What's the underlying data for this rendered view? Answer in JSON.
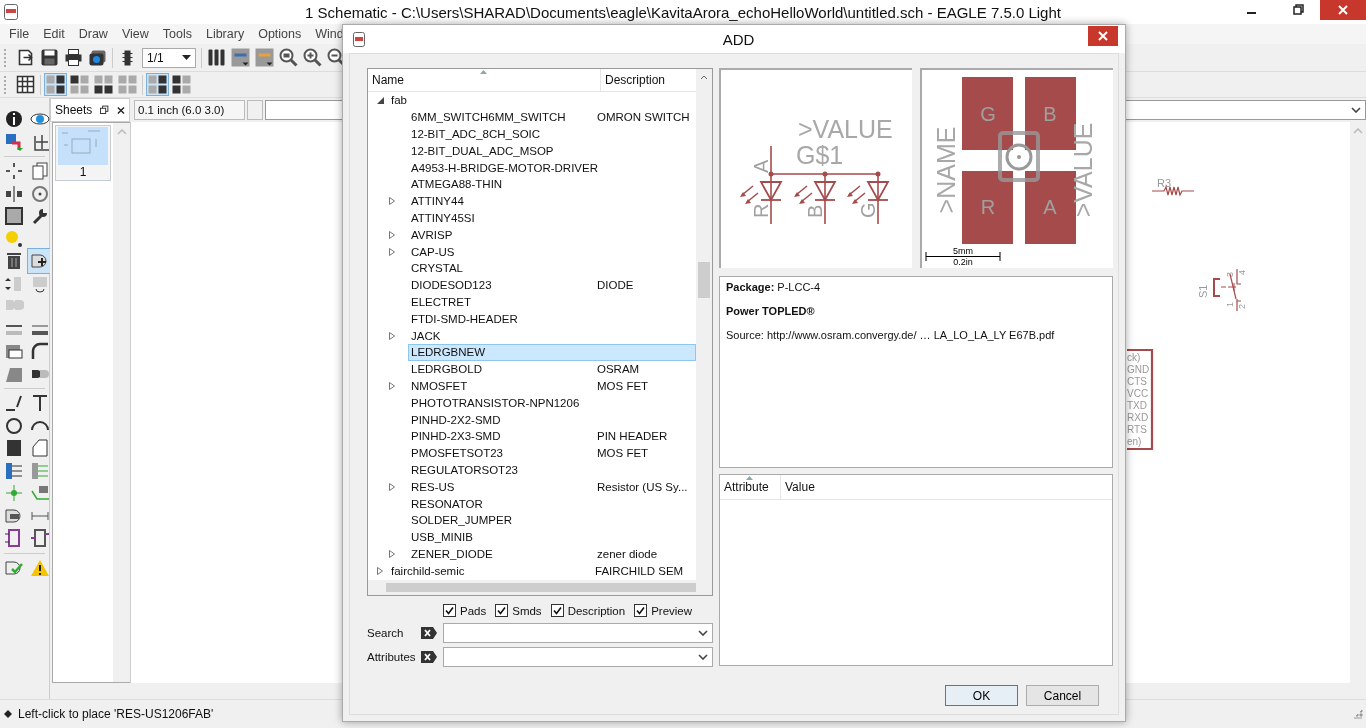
{
  "window": {
    "title": "1 Schematic - C:\\Users\\SHARAD\\Documents\\eagle\\KavitaArora_echoHelloWorld\\untitled.sch - EAGLE 7.5.0 Light"
  },
  "menu": [
    "File",
    "Edit",
    "Draw",
    "View",
    "Tools",
    "Library",
    "Options",
    "Wind"
  ],
  "toolbar": {
    "sheet_select": "1/1"
  },
  "sheets_panel": {
    "title": "Sheets",
    "sheets": [
      {
        "label": "1",
        "selected": true
      }
    ]
  },
  "coordinates": "0.1 inch (6.0 3.0)",
  "canvas": {
    "resistor_label": "R3",
    "switch_label": "S1",
    "switch_pins": [
      "3",
      "4",
      "1",
      "2"
    ],
    "connector_pins": [
      "ck)",
      "GND",
      "CTS",
      "VCC",
      "TXD",
      "RXD",
      "RTS",
      "en)"
    ]
  },
  "dialog": {
    "title": "ADD",
    "columns": [
      "Name",
      "Description"
    ],
    "tree": [
      {
        "name": "fab",
        "expanded": true,
        "selected": false,
        "children": [
          {
            "name": "6MM_SWITCH6MM_SWITCH",
            "description": "OMRON SWITCH",
            "expandable": false,
            "selected": false
          },
          {
            "name": "12-BIT_ADC_8CH_SOIC",
            "expandable": false,
            "selected": false
          },
          {
            "name": "12-BIT_DUAL_ADC_MSOP",
            "expandable": false,
            "selected": false
          },
          {
            "name": "A4953-H-BRIDGE-MOTOR-DRIVER",
            "expandable": false,
            "selected": false
          },
          {
            "name": "ATMEGA88-THIN",
            "expandable": false,
            "selected": false
          },
          {
            "name": "ATTINY44",
            "expandable": true,
            "selected": false
          },
          {
            "name": "ATTINY45SI",
            "expandable": false,
            "selected": false
          },
          {
            "name": "AVRISP",
            "expandable": true,
            "selected": false
          },
          {
            "name": "CAP-US",
            "expandable": true,
            "selected": false
          },
          {
            "name": "CRYSTAL",
            "expandable": false,
            "selected": false
          },
          {
            "name": "DIODESOD123",
            "description": "DIODE",
            "expandable": false,
            "selected": false
          },
          {
            "name": "ELECTRET",
            "expandable": false,
            "selected": false
          },
          {
            "name": "FTDI-SMD-HEADER",
            "expandable": false,
            "selected": false
          },
          {
            "name": "JACK",
            "expandable": true,
            "selected": false
          },
          {
            "name": "LEDRGBNEW",
            "expandable": false,
            "selected": true
          },
          {
            "name": "LEDRGBOLD",
            "description": "OSRAM",
            "expandable": false,
            "selected": false
          },
          {
            "name": "NMOSFET",
            "description": "MOS FET",
            "expandable": true,
            "selected": false
          },
          {
            "name": "PHOTOTRANSISTOR-NPN1206",
            "expandable": false,
            "selected": false
          },
          {
            "name": "PINHD-2X2-SMD",
            "expandable": false,
            "selected": false
          },
          {
            "name": "PINHD-2X3-SMD",
            "description": "PIN HEADER",
            "expandable": false,
            "selected": false
          },
          {
            "name": "PMOSFETSOT23",
            "description": "MOS FET",
            "expandable": false,
            "selected": false
          },
          {
            "name": "REGULATORSOT23",
            "expandable": false,
            "selected": false
          },
          {
            "name": "RES-US",
            "description": "Resistor (US Sy...",
            "expandable": true,
            "selected": false
          },
          {
            "name": "RESONATOR",
            "expandable": false,
            "selected": false
          },
          {
            "name": "SOLDER_JUMPER",
            "expandable": false,
            "selected": false
          },
          {
            "name": "USB_MINIB",
            "expandable": false,
            "selected": false
          },
          {
            "name": "ZENER_DIODE",
            "description": "zener diode",
            "expandable": true,
            "selected": false
          }
        ]
      },
      {
        "name": "fairchild-semic",
        "description": "FAIRCHILD SEM",
        "expanded": false,
        "selected": false
      }
    ],
    "filters": [
      {
        "label": "Pads",
        "checked": true
      },
      {
        "label": "Smds",
        "checked": true
      },
      {
        "label": "Description",
        "checked": true
      },
      {
        "label": "Preview",
        "checked": true
      }
    ],
    "search": {
      "label": "Search"
    },
    "attributes": {
      "label": "Attributes"
    },
    "symbol_preview": {
      "value": ">VALUE",
      "name": "G$1",
      "anode": "A",
      "leds": [
        "R",
        "B",
        "G"
      ]
    },
    "package_preview": {
      "pads": [
        "G",
        "B",
        "R",
        "A"
      ],
      "name": ">NAME",
      "value": ">VALUE",
      "scale_top": "5mm",
      "scale_bottom": "0.2in"
    },
    "details": {
      "package": "**Package:** P-LCC-4",
      "title": "Power TOPLED®",
      "source": "Source: http://www.osram.convergy.de/ … LA_LO_LA_LY E67B.pdf"
    },
    "attribute_columns": [
      "Attribute",
      "Value"
    ],
    "buttons": [
      {
        "label": "OK",
        "default": true
      },
      {
        "label": "Cancel",
        "default": false
      }
    ]
  },
  "status_bar": "Left-click to place 'RES-US1206FAB'"
}
